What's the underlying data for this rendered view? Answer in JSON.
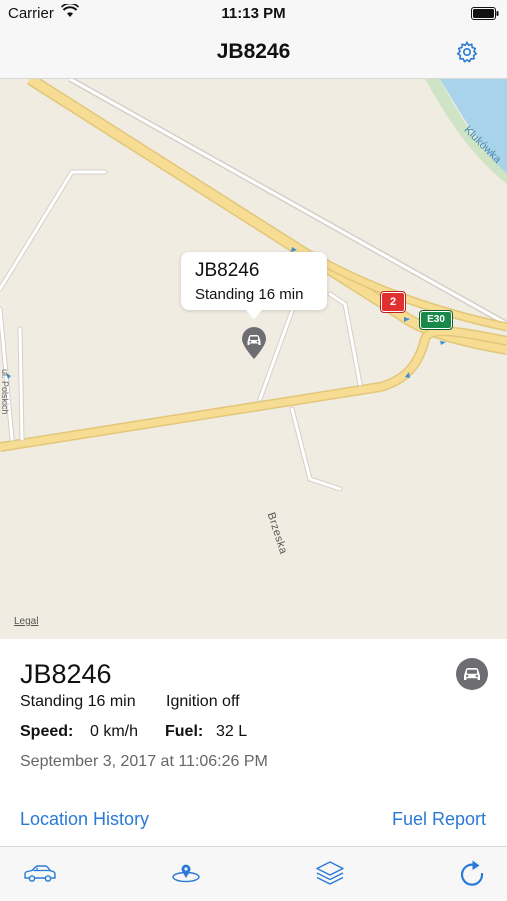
{
  "status_bar": {
    "carrier": "Carrier",
    "time": "11:13 PM"
  },
  "nav": {
    "title": "JB8246",
    "settings_icon": "gear-icon"
  },
  "map": {
    "callout": {
      "title": "JB8246",
      "subtitle": "Standing 16 min"
    },
    "road_label": "Brzeska",
    "river_label": "Klukówka",
    "street_label": "ul. Polskich",
    "route_badge_red": "2",
    "route_badge_green": "E30",
    "legal": "Legal"
  },
  "vehicle": {
    "title": "JB8246",
    "status": "Standing 16 min",
    "ignition": "Ignition off",
    "speed_label": "Speed:",
    "speed_value": "0 km/h",
    "fuel_label": "Fuel:",
    "fuel_value": "32 L",
    "timestamp": "September 3, 2017 at 11:06:26 PM",
    "status_icon": "car-icon"
  },
  "links": {
    "history": "Location History",
    "fuel_report": "Fuel Report"
  },
  "tab_bar": {
    "items": [
      "car-icon",
      "map-pin-icon",
      "layers-icon",
      "refresh-icon"
    ]
  },
  "colors": {
    "accent": "#2a7ad5",
    "map_background": "#f1ece2",
    "road_major": "#f7dc93",
    "water": "#a9d3ea"
  }
}
